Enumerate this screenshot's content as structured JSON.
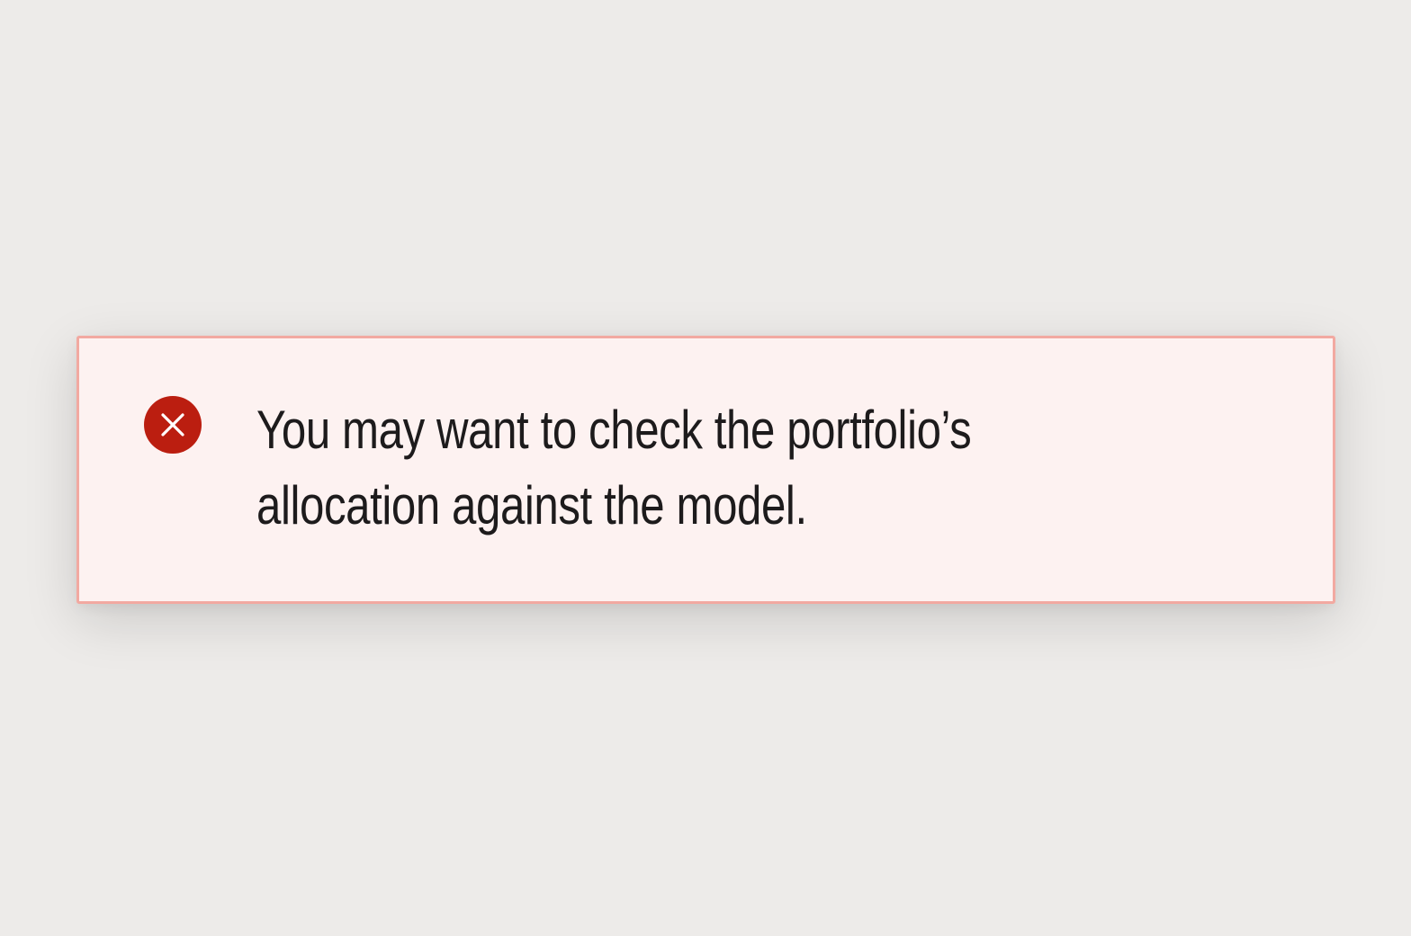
{
  "alert": {
    "type": "error",
    "icon": "error-circle-close-icon",
    "message_lines": [
      "You may want to check the portfolio’s",
      "allocation against the model."
    ]
  },
  "colors": {
    "page_background": "#edebe9",
    "alert_background": "#fdf2f1",
    "alert_border": "#f2a9a1",
    "icon_background": "#bb1e10",
    "text": "#1d1b1c"
  }
}
